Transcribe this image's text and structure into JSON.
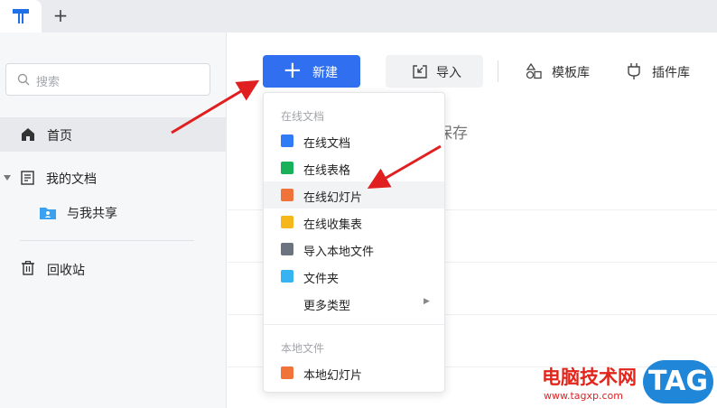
{
  "tabbar": {
    "add_tab": "+"
  },
  "sidebar": {
    "search_placeholder": "搜索",
    "items": [
      {
        "label": "首页",
        "icon": "home-icon"
      },
      {
        "label": "我的文档",
        "icon": "document-icon"
      },
      {
        "label": "与我共享",
        "icon": "shared-folder-icon"
      },
      {
        "label": "回收站",
        "icon": "trash-icon"
      }
    ]
  },
  "toolbar": {
    "new_label": "新建",
    "import_label": "导入",
    "templates_label": "模板库",
    "plugins_label": "插件库"
  },
  "main": {
    "partial_heading": "保存"
  },
  "dropdown": {
    "online_section": "在线文档",
    "items": [
      {
        "label": "在线文档",
        "icon": "online-doc-icon",
        "color": "#2f7cf6"
      },
      {
        "label": "在线表格",
        "icon": "online-sheet-icon",
        "color": "#18b15a"
      },
      {
        "label": "在线幻灯片",
        "icon": "online-slides-icon",
        "color": "#f0743a"
      },
      {
        "label": "在线收集表",
        "icon": "collection-form-icon",
        "color": "#f5b71c"
      },
      {
        "label": "导入本地文件",
        "icon": "import-file-icon",
        "color": "#6b7280"
      },
      {
        "label": "文件夹",
        "icon": "folder-icon",
        "color": "#36b3f2"
      },
      {
        "label": "更多类型",
        "icon": "",
        "color": ""
      }
    ],
    "local_section": "本地文件",
    "local_items": [
      {
        "label": "本地幻灯片",
        "icon": "local-slides-icon",
        "color": "#f0743a"
      }
    ]
  },
  "watermark": {
    "site_name": "电脑技术网",
    "url": "www.tagxp.com",
    "tag": "TAG"
  },
  "colors": {
    "accent": "#2f6ff0",
    "annotation_arrow": "#e02020"
  }
}
